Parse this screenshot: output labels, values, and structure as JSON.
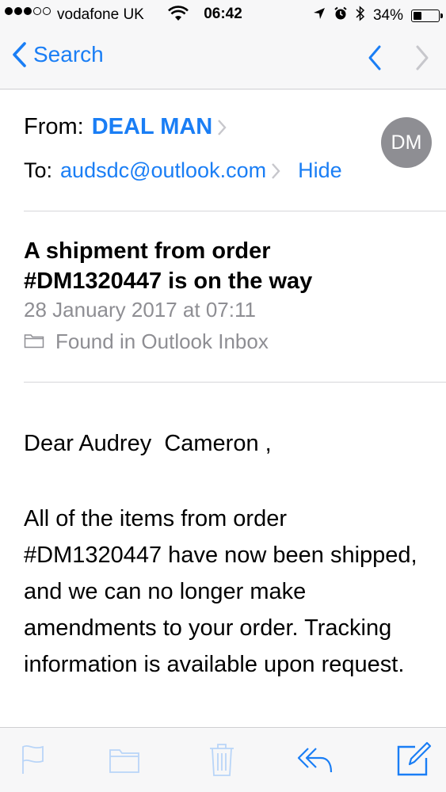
{
  "status_bar": {
    "carrier": "vodafone UK",
    "time": "06:42",
    "battery": "34%",
    "battery_level": 0.34
  },
  "nav": {
    "back_label": "Search"
  },
  "header": {
    "from_label": "From:",
    "sender": "DEAL MAN",
    "to_label": "To:",
    "recipient": "audsdc@outlook.com",
    "hide_label": "Hide",
    "avatar_initials": "DM"
  },
  "message": {
    "subject": "A shipment from order #DM1320447 is on the way",
    "date": "28 January 2017 at 07:11",
    "folder": "Found in Outlook Inbox",
    "greeting": "Dear Audrey  Cameron ,",
    "body": "All of the items from order #DM1320447 have now been shipped, and we can no longer make amendments to your order. Tracking information is available upon request."
  },
  "toolbar": {
    "icons": [
      "flag-icon",
      "folder-icon",
      "trash-icon",
      "reply-icon",
      "compose-icon"
    ]
  },
  "colors": {
    "accent": "#1a7ef5",
    "secondary_text": "#8e8e93",
    "avatar_bg": "#8e8e93",
    "bar_bg": "#f7f7f8"
  }
}
